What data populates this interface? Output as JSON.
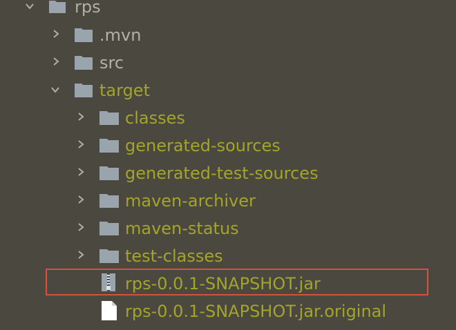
{
  "tree": {
    "items": [
      {
        "label": "rps",
        "kind": "folder",
        "state": "expanded"
      },
      {
        "label": ".mvn",
        "kind": "folder",
        "state": "collapsed"
      },
      {
        "label": "src",
        "kind": "folder",
        "state": "collapsed"
      },
      {
        "label": "target",
        "kind": "folder",
        "state": "expanded",
        "style": "excluded"
      },
      {
        "label": "classes",
        "kind": "folder",
        "state": "collapsed",
        "style": "excluded"
      },
      {
        "label": "generated-sources",
        "kind": "folder",
        "state": "collapsed",
        "style": "excluded"
      },
      {
        "label": "generated-test-sources",
        "kind": "folder",
        "state": "collapsed",
        "style": "excluded"
      },
      {
        "label": "maven-archiver",
        "kind": "folder",
        "state": "collapsed",
        "style": "excluded"
      },
      {
        "label": "maven-status",
        "kind": "folder",
        "state": "collapsed",
        "style": "excluded"
      },
      {
        "label": "test-classes",
        "kind": "folder",
        "state": "collapsed",
        "style": "excluded"
      },
      {
        "label": "rps-0.0.1-SNAPSHOT.jar",
        "kind": "jar-file",
        "style": "excluded",
        "selected": true
      },
      {
        "label": "rps-0.0.1-SNAPSHOT.jar.original",
        "kind": "file",
        "style": "excluded"
      }
    ]
  },
  "colors": {
    "background": "#4b4840",
    "normal_text": "#b3b0a4",
    "excluded_text": "#a2a52a",
    "folder_icon": "#9aa4ac",
    "highlight_border": "#d9503c"
  }
}
